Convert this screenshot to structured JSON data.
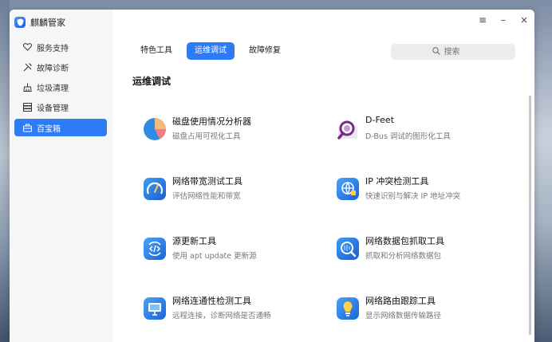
{
  "window": {
    "app_title": "麒麟管家",
    "controls": {
      "menu": "≡",
      "minimize": "–",
      "close": "×"
    }
  },
  "sidebar": {
    "items": [
      {
        "label": "服务支持",
        "icon": "heart-outline-icon",
        "active": false
      },
      {
        "label": "故障诊断",
        "icon": "tools-icon",
        "active": false
      },
      {
        "label": "垃圾清理",
        "icon": "broom-icon",
        "active": false
      },
      {
        "label": "设备管理",
        "icon": "device-list-icon",
        "active": false
      },
      {
        "label": "百宝箱",
        "icon": "toolbox-icon",
        "active": true
      }
    ]
  },
  "tabs": [
    {
      "label": "特色工具",
      "active": false
    },
    {
      "label": "运维调试",
      "active": true
    },
    {
      "label": "故障修复",
      "active": false
    }
  ],
  "search": {
    "placeholder": "搜索"
  },
  "section": {
    "title": "运维调试"
  },
  "tools": [
    {
      "name": "磁盘使用情况分析器",
      "desc": "磁盘占用可视化工具",
      "icon": "pie-chart-icon"
    },
    {
      "name": "D-Feet",
      "desc": "D-Bus 调试的图形化工具",
      "icon": "magnifier-document-icon"
    },
    {
      "name": "网络带宽测试工具",
      "desc": "评估网络性能和带宽",
      "icon": "speedometer-icon"
    },
    {
      "name": "IP 冲突检测工具",
      "desc": "快速识别与解决 IP 地址冲突",
      "icon": "globe-network-icon"
    },
    {
      "name": "源更新工具",
      "desc": "使用 apt update 更新源",
      "icon": "code-refresh-icon"
    },
    {
      "name": "网络数据包抓取工具",
      "desc": "抓取和分析网络数据包",
      "icon": "packet-capture-icon"
    },
    {
      "name": "网络连通性检测工具",
      "desc": "远程连接，诊断网络是否通畅",
      "icon": "monitor-icon"
    },
    {
      "name": "网络路由跟踪工具",
      "desc": "显示网络数据传输路径",
      "icon": "lightbulb-icon"
    }
  ],
  "colors": {
    "accent": "#2f7bf5",
    "sidebar_bg": "#f5f6f8"
  }
}
